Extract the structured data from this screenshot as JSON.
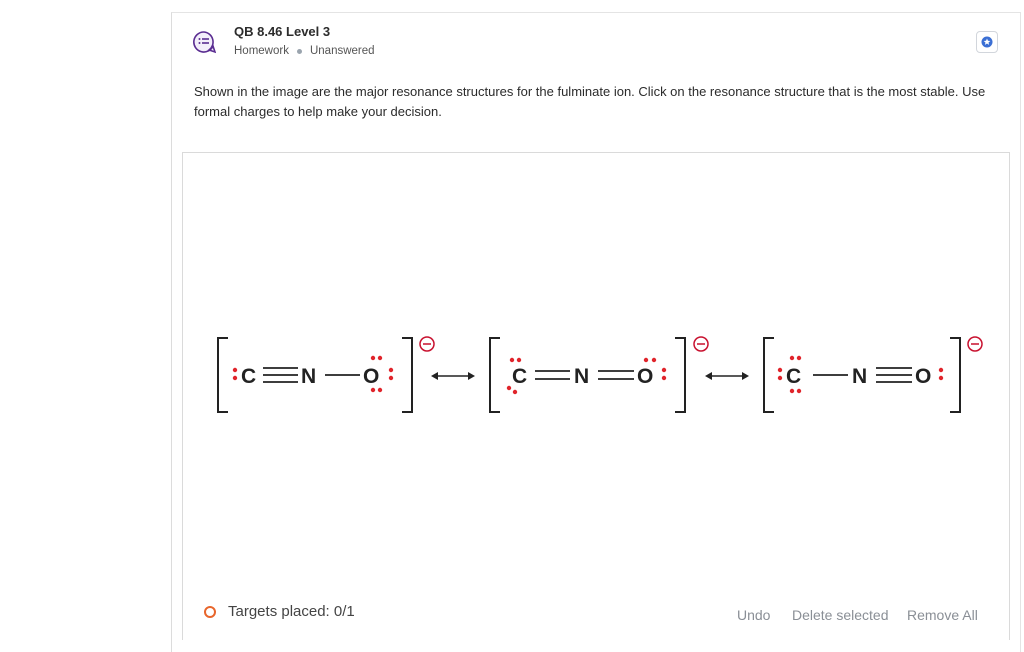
{
  "question": {
    "title": "QB 8.46 Level 3",
    "type_label": "Homework",
    "status_label": "Unanswered",
    "prompt": "Shown in the image are the major resonance structures for the fulminate ion. Click on the resonance structure that is the most stable. Use formal charges to help make your decision."
  },
  "structures": [
    {
      "left_atom": "C",
      "middle_atom": "N",
      "right_atom": "O",
      "charge": "−"
    },
    {
      "left_atom": "C",
      "middle_atom": "N",
      "right_atom": "O",
      "charge": "−"
    },
    {
      "left_atom": "C",
      "middle_atom": "N",
      "right_atom": "O",
      "charge": "−"
    }
  ],
  "footer": {
    "targets_label": "Targets placed: 0/1",
    "undo_label": "Undo",
    "delete_label": "Delete selected",
    "remove_all_label": "Remove All"
  },
  "colors": {
    "accent": "#5a2d91",
    "star": "#3b6fd4",
    "lone_pair": "#e0242b",
    "target_ring": "#e8662c",
    "charge": "#c8102e"
  },
  "icons": {
    "question_icon": "question-list-icon",
    "star_icon": "star-icon",
    "targets_icon": "target-ring-icon"
  }
}
